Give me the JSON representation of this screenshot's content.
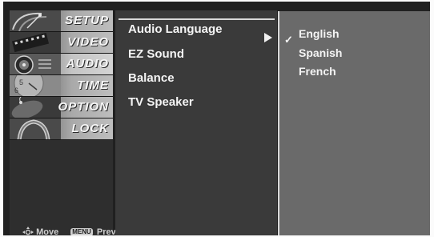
{
  "categories": [
    {
      "label": "SETUP",
      "icon": "satellite-dish-icon"
    },
    {
      "label": "VIDEO",
      "icon": "film-reel-icon"
    },
    {
      "label": "AUDIO",
      "icon": "speaker-icon"
    },
    {
      "label": "TIME",
      "icon": "clock-icon"
    },
    {
      "label": "OPTION",
      "icon": "option-tag-icon"
    },
    {
      "label": "LOCK",
      "icon": "padlock-icon"
    }
  ],
  "active_category": "AUDIO",
  "navigation": {
    "move_label": "Move",
    "prev_label": "Prev",
    "menu_key_label": "MENU"
  },
  "submenu": {
    "items": [
      "Audio Language",
      "EZ Sound",
      "Balance",
      "TV Speaker"
    ],
    "selected": "Audio Language"
  },
  "options": {
    "items": [
      "English",
      "Spanish",
      "French"
    ],
    "checked": "English"
  },
  "colors": {
    "background": "#202020",
    "submenu": "#3a3a3a",
    "options": "#6a6a6a",
    "text": "#f4f4f4"
  }
}
